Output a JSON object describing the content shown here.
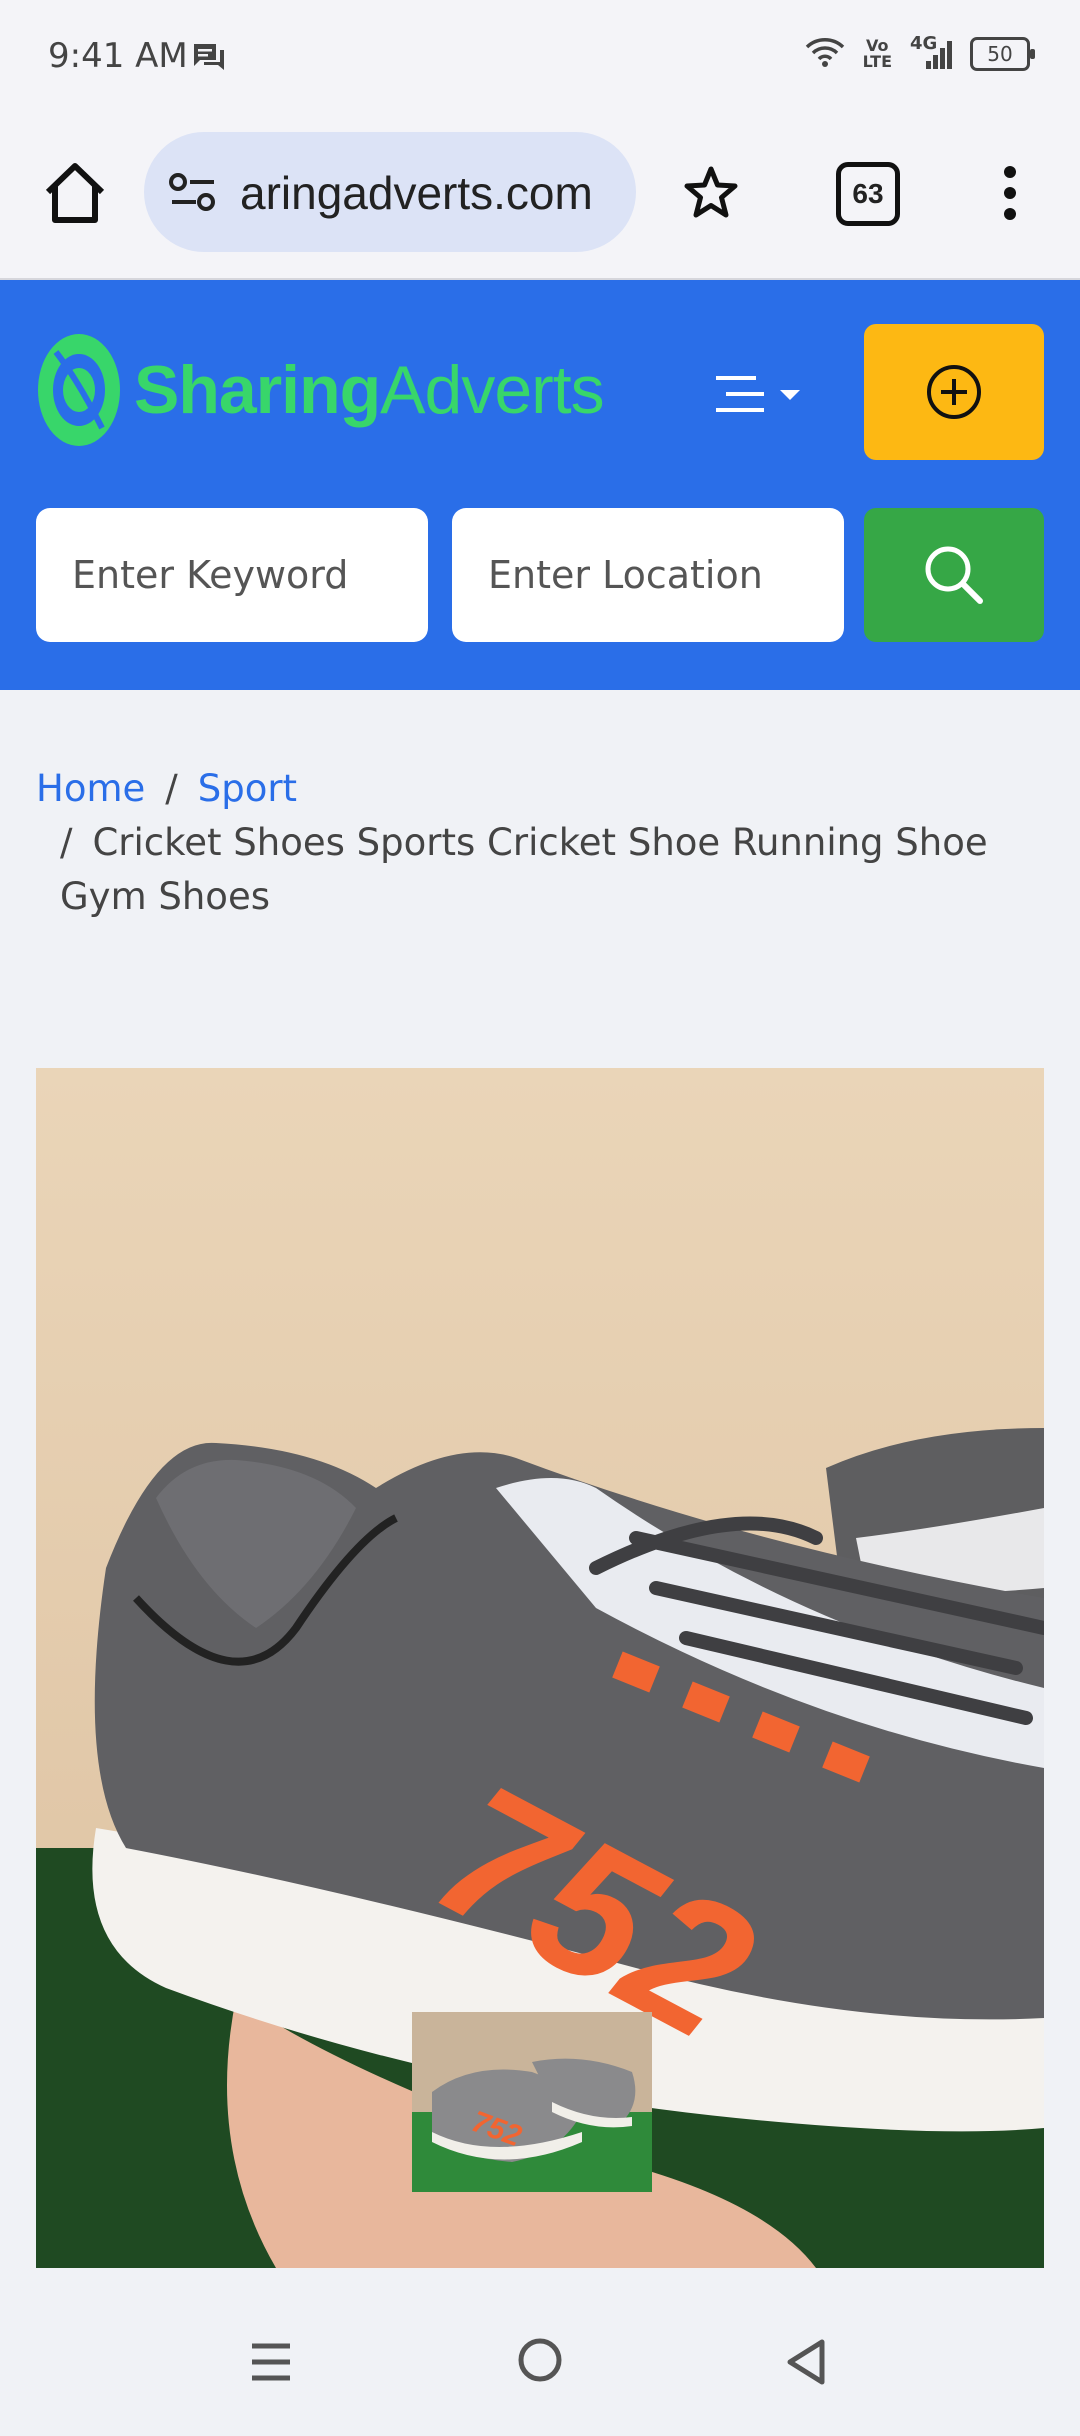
{
  "status_bar": {
    "time": "9:41 AM",
    "network_volte_top": "Vo",
    "network_volte_bottom": "LTE",
    "network_type": "4G",
    "battery": "50"
  },
  "browser": {
    "url": "aringadverts.com",
    "tab_count": "63"
  },
  "site": {
    "logo_part1": "Sharing",
    "logo_part2": "Adverts",
    "keyword_placeholder": "Enter Keyword",
    "location_placeholder": "Enter Location",
    "colors": {
      "header_bg": "#2a6ee8",
      "post_button": "#fdb813",
      "search_button": "#36a746",
      "logo_green": "#38d66a"
    }
  },
  "breadcrumb": {
    "home": "Home",
    "separator": "/",
    "category": "Sport",
    "current": "Cricket Shoes Sports Cricket Shoe Running Shoe Gym Shoes"
  },
  "product_image": {
    "shoe_print": "752"
  }
}
